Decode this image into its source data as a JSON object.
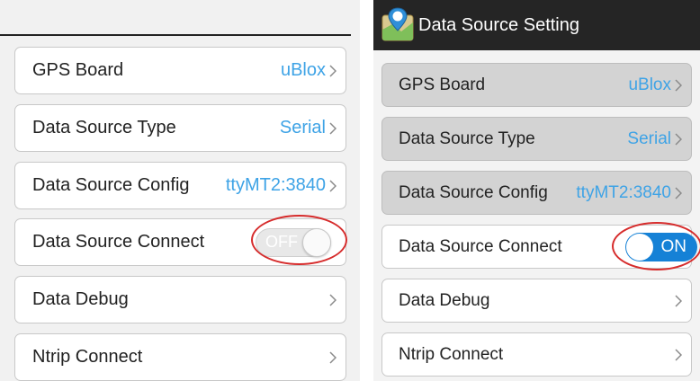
{
  "left": {
    "rows": [
      {
        "label": "GPS Board",
        "value": "uBlox"
      },
      {
        "label": "Data Source Type",
        "value": "Serial"
      },
      {
        "label": "Data Source Config",
        "value": "ttyMT2:3840"
      },
      {
        "label": "Data Source Connect",
        "toggle": "OFF"
      },
      {
        "label": "Data Debug"
      },
      {
        "label": "Ntrip Connect"
      }
    ]
  },
  "right": {
    "title": "Data Source Setting",
    "app_icon": "gis-map-pin-icon",
    "rows": [
      {
        "label": "GPS Board",
        "value": "uBlox"
      },
      {
        "label": "Data Source Type",
        "value": "Serial"
      },
      {
        "label": "Data Source Config",
        "value": "ttyMT2:3840"
      },
      {
        "label": "Data Source Connect",
        "toggle": "ON"
      },
      {
        "label": "Data Debug"
      },
      {
        "label": "Ntrip Connect"
      }
    ]
  },
  "colors": {
    "value_text": "#3ea3e6",
    "switch_on": "#1581d6",
    "highlight_ring": "#d62c2c",
    "title_bar": "#252525"
  }
}
